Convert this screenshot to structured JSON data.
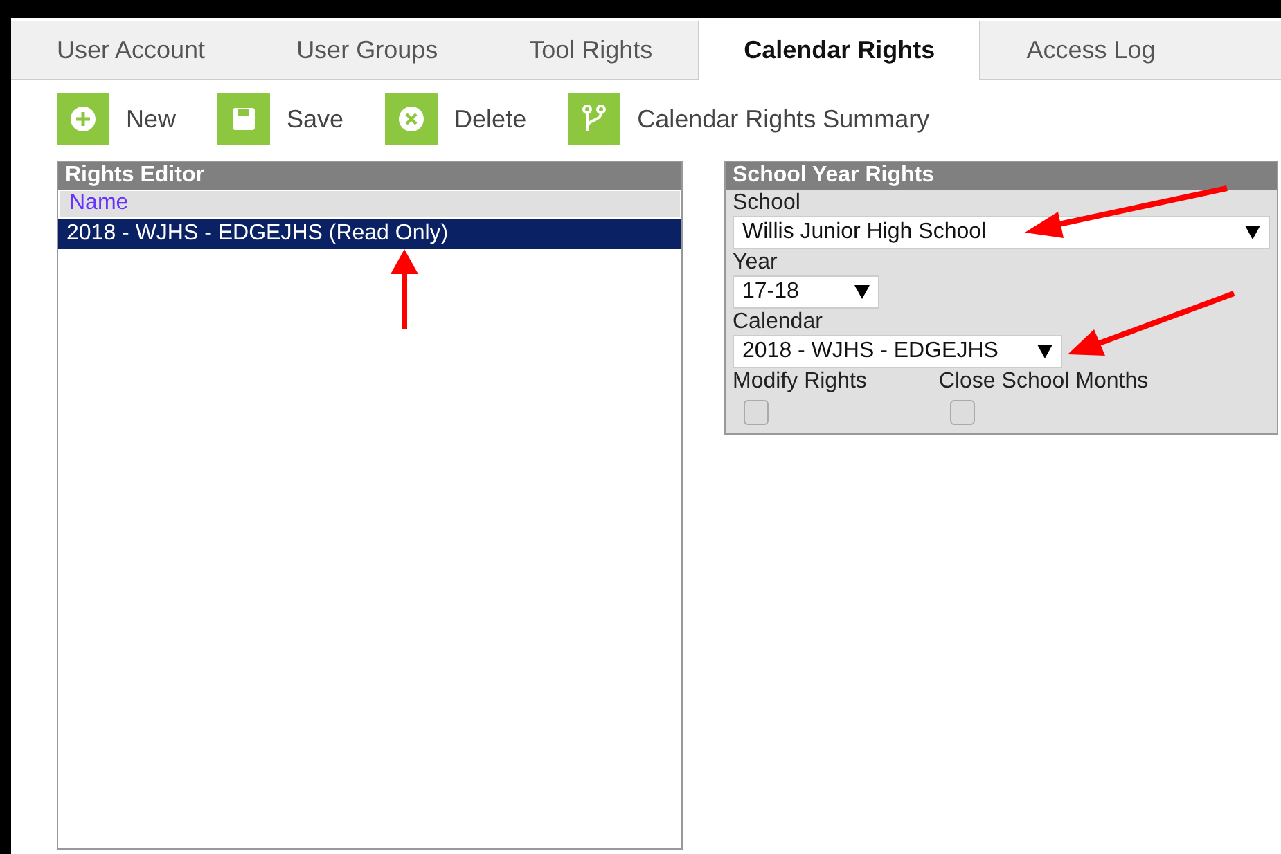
{
  "tabs": [
    {
      "label": "User Account",
      "selected": false
    },
    {
      "label": "User Groups",
      "selected": false
    },
    {
      "label": "Tool Rights",
      "selected": false
    },
    {
      "label": "Calendar Rights",
      "selected": true
    },
    {
      "label": "Access Log",
      "selected": false
    }
  ],
  "toolbar": [
    {
      "kind": "new",
      "label": "New"
    },
    {
      "kind": "save",
      "label": "Save"
    },
    {
      "kind": "delete",
      "label": "Delete"
    },
    {
      "kind": "summary",
      "label": "Calendar Rights Summary"
    }
  ],
  "rights_editor": {
    "title": "Rights Editor",
    "column": "Name",
    "rows": [
      {
        "label": "2018 - WJHS - EDGEJHS (Read Only)",
        "selected": true
      }
    ]
  },
  "school_year_rights": {
    "title": "School Year Rights",
    "school": {
      "label": "School",
      "value": "Willis Junior High School"
    },
    "year": {
      "label": "Year",
      "value": "17-18"
    },
    "calendar": {
      "label": "Calendar",
      "value": "2018 - WJHS - EDGEJHS"
    },
    "checkboxes": [
      {
        "label": "Modify Rights",
        "checked": false
      },
      {
        "label": "Close School Months",
        "checked": false
      }
    ]
  }
}
